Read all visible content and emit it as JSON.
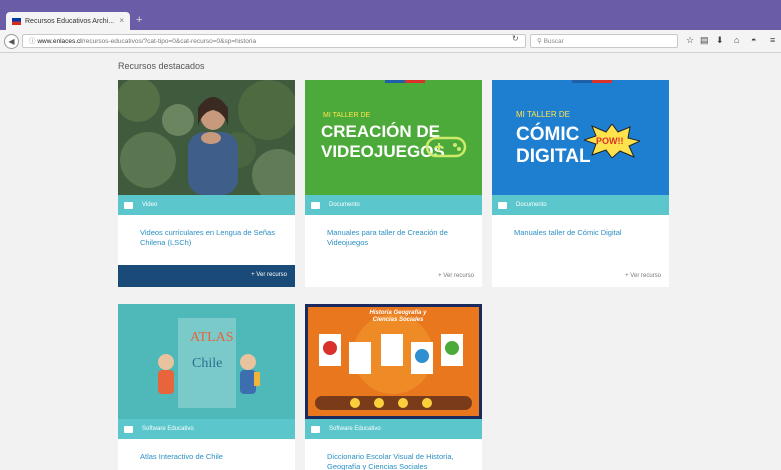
{
  "browser": {
    "tab_title": "Recursos Educativos Archi...",
    "tab_close": "×",
    "new_tab": "+",
    "url_domain": "www.enlaces.cl",
    "url_path": "/recursos-educativos/?cat-tipo=0&cat-recurso=0&sp=historia",
    "search_placeholder": "Buscar"
  },
  "page": {
    "heading": "Recursos destacados"
  },
  "cards": [
    {
      "category": "Video",
      "title": "Videos curriculares en Lengua de Señas Chilena (LSCh)",
      "link": "+ Ver recurso"
    },
    {
      "category": "Documento",
      "title": "Manuales para taller de Creación de Videojuegos",
      "link": "+ Ver recurso",
      "thumb_line1": "MI TALLER DE",
      "thumb_line2": "CREACIÓN DE",
      "thumb_line3": "VIDEOJUEGOS"
    },
    {
      "category": "Documento",
      "title": "Manuales taller de Cómic Digital",
      "link": "+ Ver recurso",
      "thumb_line1": "MI TALLER DE",
      "thumb_line2": "CÓMIC",
      "thumb_line3": "DIGITAL",
      "thumb_pow": "POW!!"
    },
    {
      "category": "Software Educativo",
      "title": "Atlas Interactivo de Chile",
      "thumb_line1": "ATLAS",
      "thumb_line2": "Chile"
    },
    {
      "category": "Software Educativo",
      "title": "Diccionario Escolar Visual de Historia, Geografía y Ciencias Sociales",
      "thumb_line1": "Historia Geografía y Ciencias Sociales"
    }
  ],
  "colors": {
    "teal": "#5bc6cb",
    "navy": "#1a4a78",
    "link": "#2b8fc4",
    "purple": "#6b5ca8"
  }
}
